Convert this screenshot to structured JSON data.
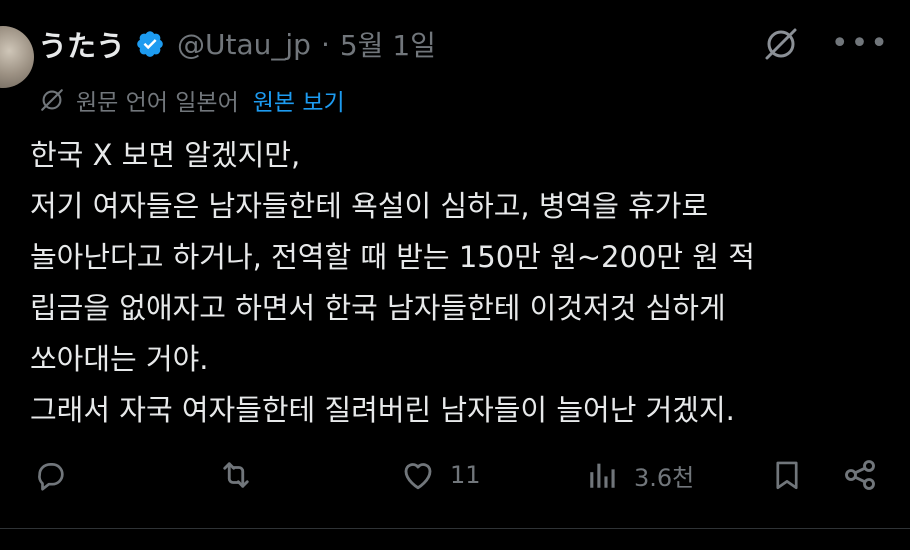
{
  "tweet": {
    "author_name": "うたう",
    "handle": "@Utau_jp",
    "separator": "·",
    "date": "5월 1일",
    "translation": {
      "label": "원문 언어 일본어",
      "link": "원본 보기"
    },
    "lines": [
      "한국 X 보면 알겠지만,",
      "저기 여자들은 남자들한테 욕설이 심하고, 병역을 휴가로",
      "놀아난다고 하거나, 전역할 때 받는 150만 원~200만 원 적",
      "립금을 없애자고 하면서 한국 남자들한테 이것저것 심하게",
      "쏘아대는 거야.",
      "그래서 자국 여자들한테 질려버린 남자들이 늘어난 거겠지."
    ],
    "stats": {
      "likes": "11",
      "views": "3.6천"
    }
  },
  "icons": {
    "verified": "verified-badge-icon",
    "grok": "grok-icon",
    "more": "more-icon",
    "reply": "reply-icon",
    "retweet": "retweet-icon",
    "like": "heart-icon",
    "views": "views-icon",
    "bookmark": "bookmark-icon",
    "share": "share-icon"
  },
  "colors": {
    "background": "#000000",
    "text": "#e7e9ea",
    "muted": "#71767b",
    "accent": "#1d9bf0"
  }
}
